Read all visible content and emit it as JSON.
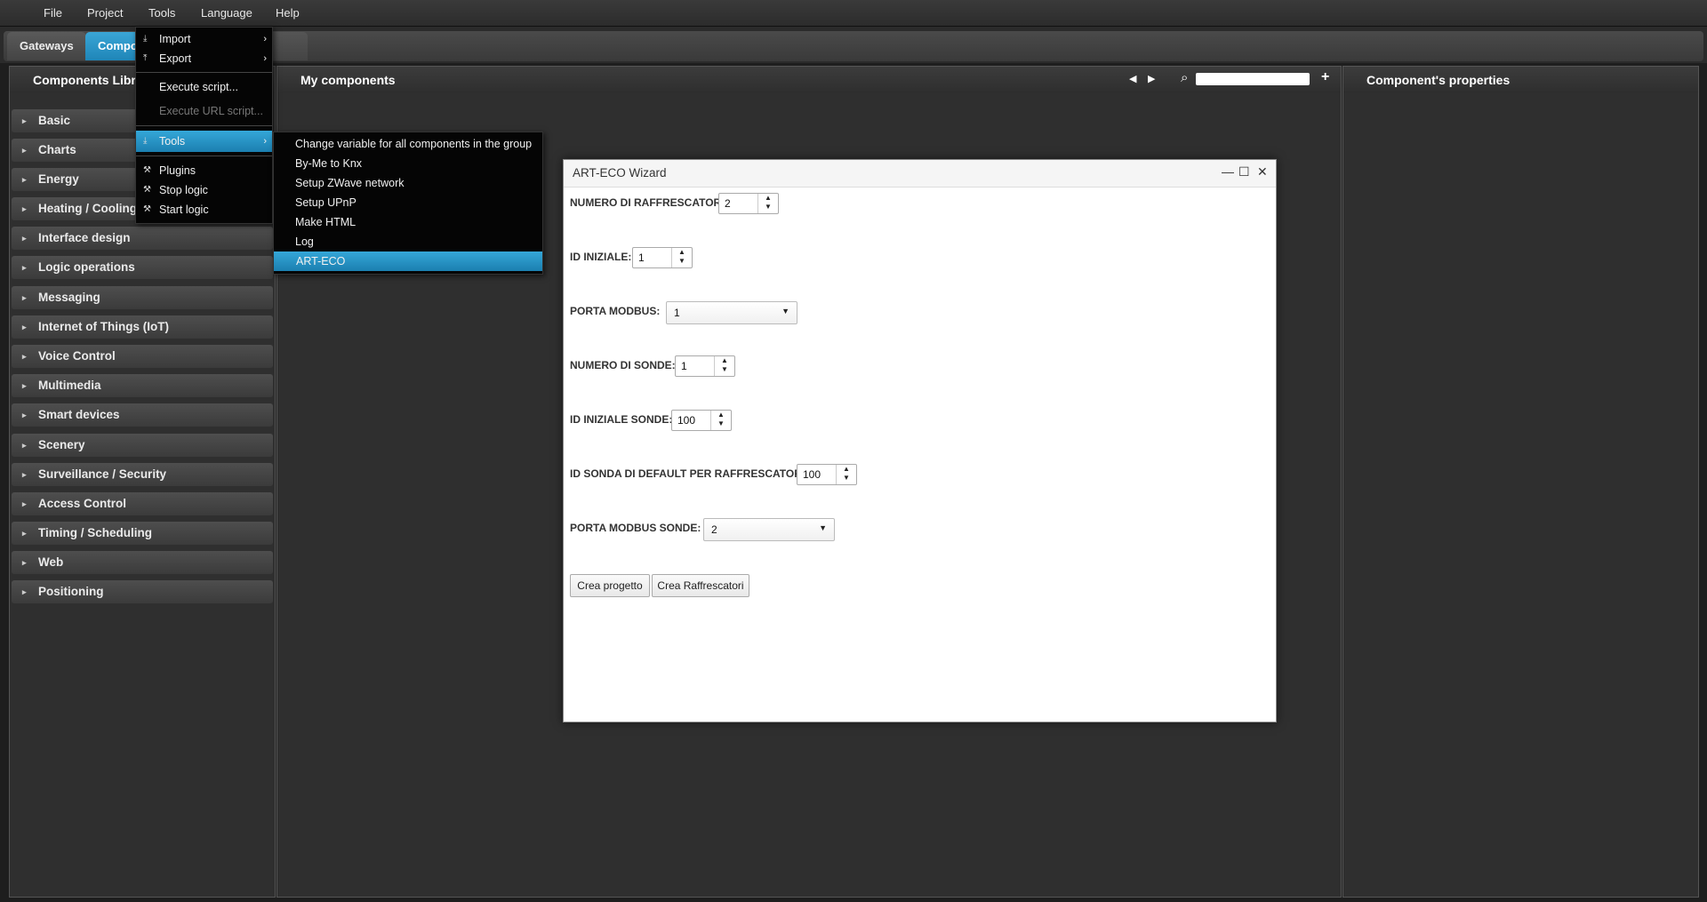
{
  "menubar": {
    "items": [
      "File",
      "Project",
      "Tools",
      "Language",
      "Help"
    ]
  },
  "tabs": {
    "gateways": "Gateways",
    "components": "Compo"
  },
  "library": {
    "title": "Components Libra",
    "items": [
      "Basic",
      "Charts",
      "Energy",
      "Heating / Cooling",
      "Interface design",
      "Logic operations",
      "Messaging",
      "Internet of Things (IoT)",
      "Voice Control",
      "Multimedia",
      "Smart devices",
      "Scenery",
      "Surveillance / Security",
      "Access Control",
      "Timing / Scheduling",
      "Web",
      "Positioning"
    ]
  },
  "main": {
    "title": "My components",
    "search_value": ""
  },
  "properties": {
    "title": "Component's properties"
  },
  "tools_menu": {
    "items": [
      {
        "label": "Import",
        "icon": "import-icon",
        "submenu": true
      },
      {
        "label": "Export",
        "icon": "export-icon",
        "submenu": true
      },
      {
        "label": "Execute script..."
      },
      {
        "label": "Execute URL script...",
        "disabled": true
      },
      {
        "label": "Tools",
        "icon": "tools-icon",
        "submenu": true,
        "selected": true
      },
      {
        "label": "Plugins",
        "icon": "wrench-icon"
      },
      {
        "label": "Stop logic",
        "icon": "wrench-icon"
      },
      {
        "label": "Start logic",
        "icon": "wrench-icon"
      }
    ]
  },
  "tools_submenu": {
    "items": [
      "Change variable for all components in the group",
      "By-Me to Knx",
      "Setup ZWave network",
      "Setup UPnP",
      "Make HTML",
      "Log",
      "ART-ECO"
    ],
    "selected": "ART-ECO"
  },
  "wizard": {
    "title": "ART-ECO Wizard",
    "fields": {
      "num_raffrescatori": {
        "label": "NUMERO DI RAFFRESCATORI:",
        "value": "2"
      },
      "id_iniziale": {
        "label": "ID INIZIALE:",
        "value": "1"
      },
      "porta_modbus": {
        "label": "PORTA MODBUS:",
        "value": "1"
      },
      "num_sonde": {
        "label": "NUMERO DI SONDE:",
        "value": "1"
      },
      "id_iniziale_sonde": {
        "label": "ID INIZIALE SONDE:",
        "value": "100"
      },
      "id_sonda_default": {
        "label": "ID SONDA DI DEFAULT PER RAFFRESCATORI:",
        "value": "100"
      },
      "porta_modbus_sonde": {
        "label": "PORTA MODBUS SONDE:",
        "value": "2"
      }
    },
    "buttons": {
      "crea_progetto": "Crea progetto",
      "crea_raffrescatori": "Crea Raffrescatori"
    }
  },
  "glyphs": {
    "arrow_right": "▸",
    "submenu": "›",
    "up": "▲",
    "down": "▼",
    "dropdown": "▼",
    "minimize": "—",
    "maximize": "☐",
    "close": "✕",
    "back": "◀",
    "forward": "▶",
    "search": "⌕",
    "plus": "+",
    "import": "⤓",
    "export": "⤒",
    "wrench": "🔧"
  }
}
